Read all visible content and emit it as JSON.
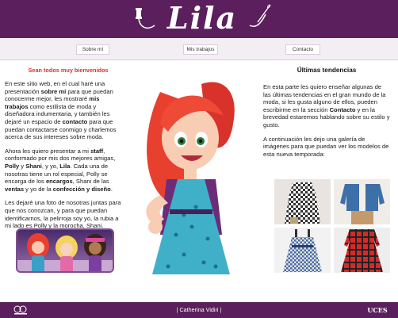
{
  "header": {
    "logo_text": "Lila",
    "brand_color": "#5a1f5c"
  },
  "nav": {
    "items": [
      {
        "label": "Sobre mí"
      },
      {
        "label": "Mis trabajos"
      },
      {
        "label": "Contacto"
      }
    ]
  },
  "left": {
    "welcome": "Sean todos muy bienvenidos",
    "p1": {
      "t1": "En este sitio web, en el cual haré una presentación ",
      "b1": "sobre mí",
      "t2": " para que puedan conocerme mejor, les mostraré ",
      "b2": "mis trabajos",
      "t3": " como estilista de moda y diseñadora indumentaria, y también les dejaré un espacio de ",
      "b3": "contacto",
      "t4": " para que puedan contactarse conmigo y charlemos acerca de sus intereses sobre moda."
    },
    "p2": {
      "t1": "Ahora les quiero presentar a mi ",
      "b1": "staff",
      "t2": ", conformado por mis dos mejores amigas, ",
      "b2": "Polly",
      "t3": " y ",
      "b3": "Shani",
      "t4": ", y yo, ",
      "b4": "Lila",
      "t5": ". Cada una de nosotras tiene un rol especial, Polly se encarga de los ",
      "b5": "encargos",
      "t6": ", Shani de las ",
      "b6": "ventas",
      "t7": " y yo de la ",
      "b7": "confección y diseño",
      "t8": "."
    },
    "p3": "Les dejaré una foto de nosotras juntas para que nos conozcan, y para que puedan identificarnos, la pelirroja soy yo, la rubia a mi lado es Polly y la morocha, Shani."
  },
  "right": {
    "title": "Últimas tendencias",
    "p1": {
      "t1": "En esta parte les quiero enseñar algunas de las últimas tendencias en el gran mundo de la moda, si les gusta alguno de ellos, pueden escribirme en la sección ",
      "b1": "Contacto",
      "t2": " y en la brevedad estaremos hablando sobre su estilo y gusto."
    },
    "p2": "A continuación les dejo una galería de imágenes para que puedan ver los modelos de esta nueva temporada:"
  },
  "footer": {
    "name": "| Catherina Vidiri |",
    "right_logo": "UCES"
  }
}
